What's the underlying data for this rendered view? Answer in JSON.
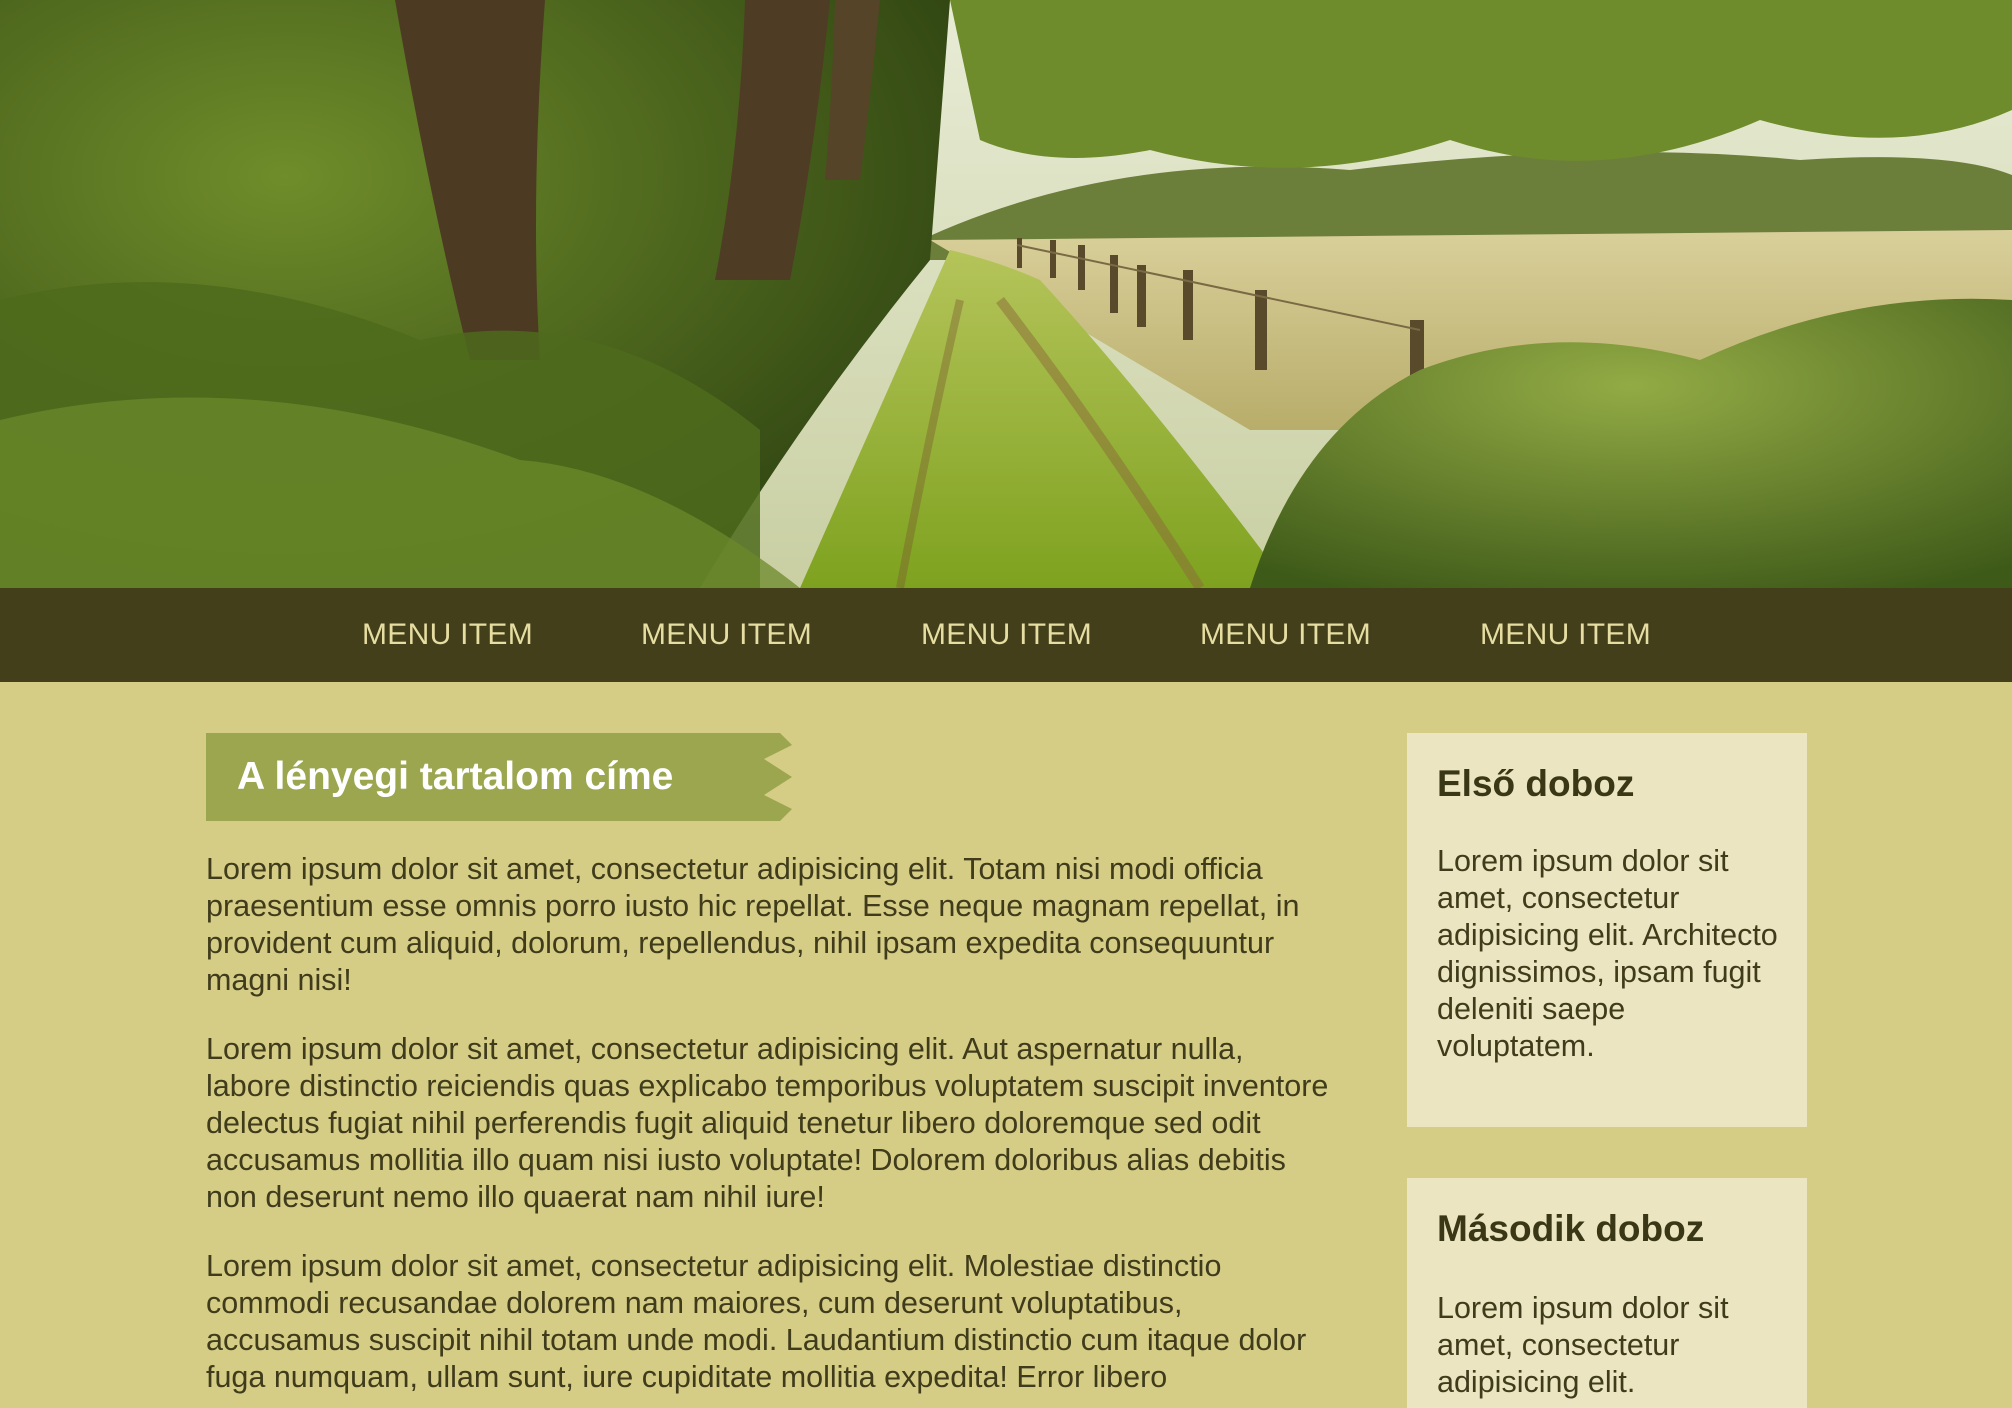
{
  "nav": {
    "items": [
      {
        "label": "MENU ITEM"
      },
      {
        "label": "MENU ITEM"
      },
      {
        "label": "MENU ITEM"
      },
      {
        "label": "MENU ITEM"
      },
      {
        "label": "MENU ITEM"
      }
    ]
  },
  "main": {
    "title": "A lényegi tartalom címe",
    "paragraphs": [
      "Lorem ipsum dolor sit amet, consectetur adipisicing elit. Totam nisi modi officia praesentium esse omnis porro iusto hic repellat. Esse neque magnam repellat, in provident cum aliquid, dolorum, repellendus, nihil ipsam expedita consequuntur magni nisi!",
      "Lorem ipsum dolor sit amet, consectetur adipisicing elit. Aut aspernatur nulla, labore distinctio reiciendis quas explicabo temporibus voluptatem suscipit inventore delectus fugiat nihil perferendis fugit aliquid tenetur libero doloremque sed odit accusamus mollitia illo quam nisi iusto voluptate! Dolorem doloribus alias debitis non deserunt nemo illo quaerat nam nihil iure!",
      "Lorem ipsum dolor sit amet, consectetur adipisicing elit. Molestiae distinctio commodi recusandae dolorem nam maiores, cum deserunt voluptatibus, accusamus suscipit nihil totam unde modi. Laudantium distinctio cum itaque dolor fuga numquam, ullam sunt, iure cupiditate mollitia expedita! Error libero"
    ]
  },
  "sidebar": {
    "boxes": [
      {
        "title": "Első doboz",
        "text": "Lorem ipsum dolor sit amet, consectetur adipisicing elit. Architecto dignissimos, ipsam fugit deleniti saepe voluptatem."
      },
      {
        "title": "Második doboz",
        "text": "Lorem ipsum dolor sit amet, consectetur adipisicing elit."
      }
    ]
  },
  "colors": {
    "page_background": "#d5cd86",
    "nav_background": "#433f1b",
    "nav_text": "#e6dda2",
    "title_ribbon": "#9ba64e",
    "side_box_background": "#ebe5c2",
    "body_text": "#3f3b1b"
  }
}
